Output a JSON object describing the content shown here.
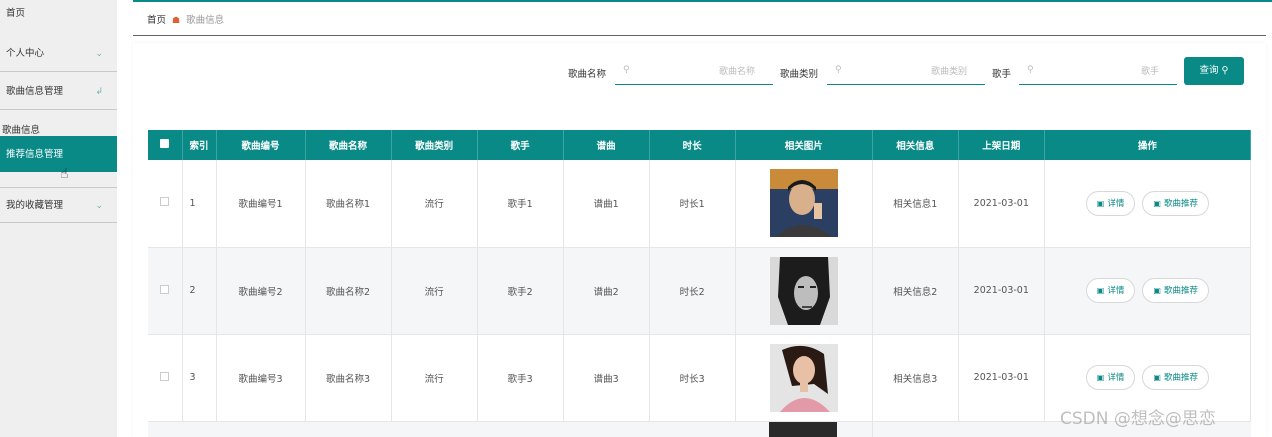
{
  "sidebar": {
    "home": "首页",
    "personal": "个人中心",
    "song_mgmt": "歌曲信息管理",
    "song_info": "歌曲信息",
    "recommend": "推荐信息管理",
    "favorites": "我的收藏管理"
  },
  "breadcrumb": {
    "home": "首页",
    "current": "歌曲信息"
  },
  "search": {
    "name_label": "歌曲名称",
    "name_placeholder": "歌曲名称",
    "type_label": "歌曲类别",
    "type_placeholder": "歌曲类别",
    "singer_label": "歌手",
    "singer_placeholder": "歌手",
    "button": "查询"
  },
  "table": {
    "headers": [
      "索引",
      "歌曲编号",
      "歌曲名称",
      "歌曲类别",
      "歌手",
      "谱曲",
      "时长",
      "相关图片",
      "相关信息",
      "上架日期",
      "操作"
    ],
    "rows": [
      {
        "index": "1",
        "code": "歌曲编号1",
        "name": "歌曲名称1",
        "type": "流行",
        "singer": "歌手1",
        "composer": "谱曲1",
        "duration": "时长1",
        "info": "相关信息1",
        "date": "2021-03-01"
      },
      {
        "index": "2",
        "code": "歌曲编号2",
        "name": "歌曲名称2",
        "type": "流行",
        "singer": "歌手2",
        "composer": "谱曲2",
        "duration": "时长2",
        "info": "相关信息2",
        "date": "2021-03-01"
      },
      {
        "index": "3",
        "code": "歌曲编号3",
        "name": "歌曲名称3",
        "type": "流行",
        "singer": "歌手3",
        "composer": "谱曲3",
        "duration": "时长3",
        "info": "相关信息3",
        "date": "2021-03-01"
      }
    ],
    "detail_label": "详情",
    "recommend_label": "歌曲推荐"
  },
  "watermark": "CSDN @想念@思恋",
  "colors": {
    "accent": "#0a8a87",
    "crumb_icon": "#e06030"
  }
}
